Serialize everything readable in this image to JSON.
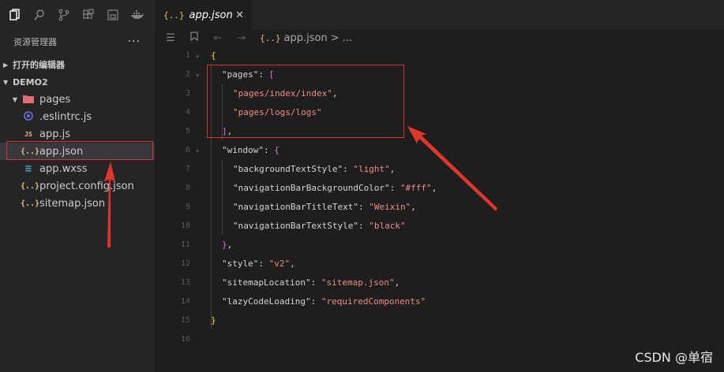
{
  "activity": {
    "icons": [
      "explorer-icon",
      "search-icon",
      "source-control-icon",
      "extensions-icon",
      "remote-icon",
      "docker-icon"
    ]
  },
  "sidebar": {
    "title": "资源管理器",
    "more": "···",
    "sections": {
      "open_editors": "打开的编辑器",
      "project": "DEMO2"
    },
    "items": [
      {
        "name": "pages",
        "icon": "folder-icon",
        "color": "#e06c75",
        "glyph": "▆"
      },
      {
        "name": ".eslintrc.js",
        "icon": "eslint-icon",
        "color": "#6c6cf0",
        "glyph": "◉"
      },
      {
        "name": "app.js",
        "icon": "js-icon",
        "color": "#e5c07b",
        "glyph": "JS"
      },
      {
        "name": "app.json",
        "icon": "json-icon",
        "color": "#e5c07b",
        "glyph": "{..}"
      },
      {
        "name": "app.wxss",
        "icon": "css-icon",
        "color": "#519aba",
        "glyph": "≋"
      },
      {
        "name": "project.config.json",
        "icon": "json-icon",
        "color": "#e5c07b",
        "glyph": "{..}"
      },
      {
        "name": "sitemap.json",
        "icon": "json-icon",
        "color": "#e5c07b",
        "glyph": "{..}"
      }
    ]
  },
  "tab": {
    "icon_glyph": "{..}",
    "label": "app.json",
    "close": "✕"
  },
  "breadcrumb": {
    "file": "app.json",
    "sep": ">",
    "rest": "..."
  },
  "code": {
    "line_numbers": [
      "1",
      "2",
      "3",
      "4",
      "5",
      "6",
      "7",
      "8",
      "9",
      "10",
      "11",
      "12",
      "13",
      "14",
      "15",
      "16"
    ]
  },
  "watermark": "CSDN @单宿",
  "colors": {
    "highlight": "#d8342d",
    "arrow": "#e2352a"
  }
}
